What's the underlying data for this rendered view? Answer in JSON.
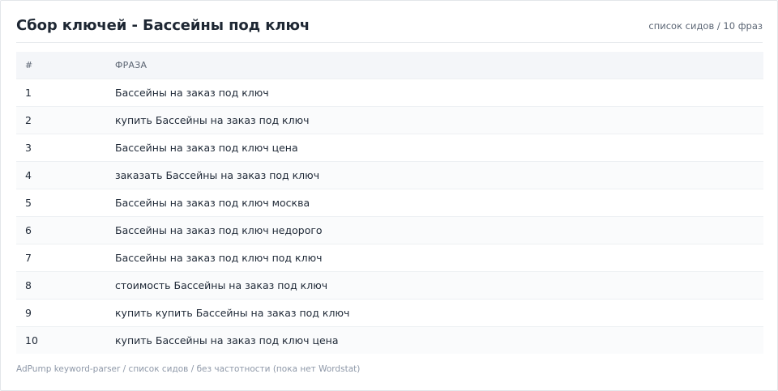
{
  "header": {
    "title": "Сбор ключей - Бассейны под ключ",
    "meta": "список сидов / 10 фраз"
  },
  "table": {
    "columns": [
      "#",
      "ФРАЗА"
    ],
    "rows": [
      {
        "num": "1",
        "phrase": "Бассейны на заказ под ключ"
      },
      {
        "num": "2",
        "phrase": "купить Бассейны на заказ под ключ"
      },
      {
        "num": "3",
        "phrase": "Бассейны на заказ под ключ цена"
      },
      {
        "num": "4",
        "phrase": "заказать Бассейны на заказ под ключ"
      },
      {
        "num": "5",
        "phrase": "Бассейны на заказ под ключ москва"
      },
      {
        "num": "6",
        "phrase": "Бассейны на заказ под ключ недорого"
      },
      {
        "num": "7",
        "phrase": "Бассейны на заказ под ключ под ключ"
      },
      {
        "num": "8",
        "phrase": "стоимость Бассейны на заказ под ключ"
      },
      {
        "num": "9",
        "phrase": "купить купить Бассейны на заказ под ключ"
      },
      {
        "num": "10",
        "phrase": "купить Бассейны на заказ под ключ цена"
      }
    ]
  },
  "footer": {
    "text": "AdPump keyword-parser / список сидов / без частотности (пока нет Wordstat)"
  }
}
